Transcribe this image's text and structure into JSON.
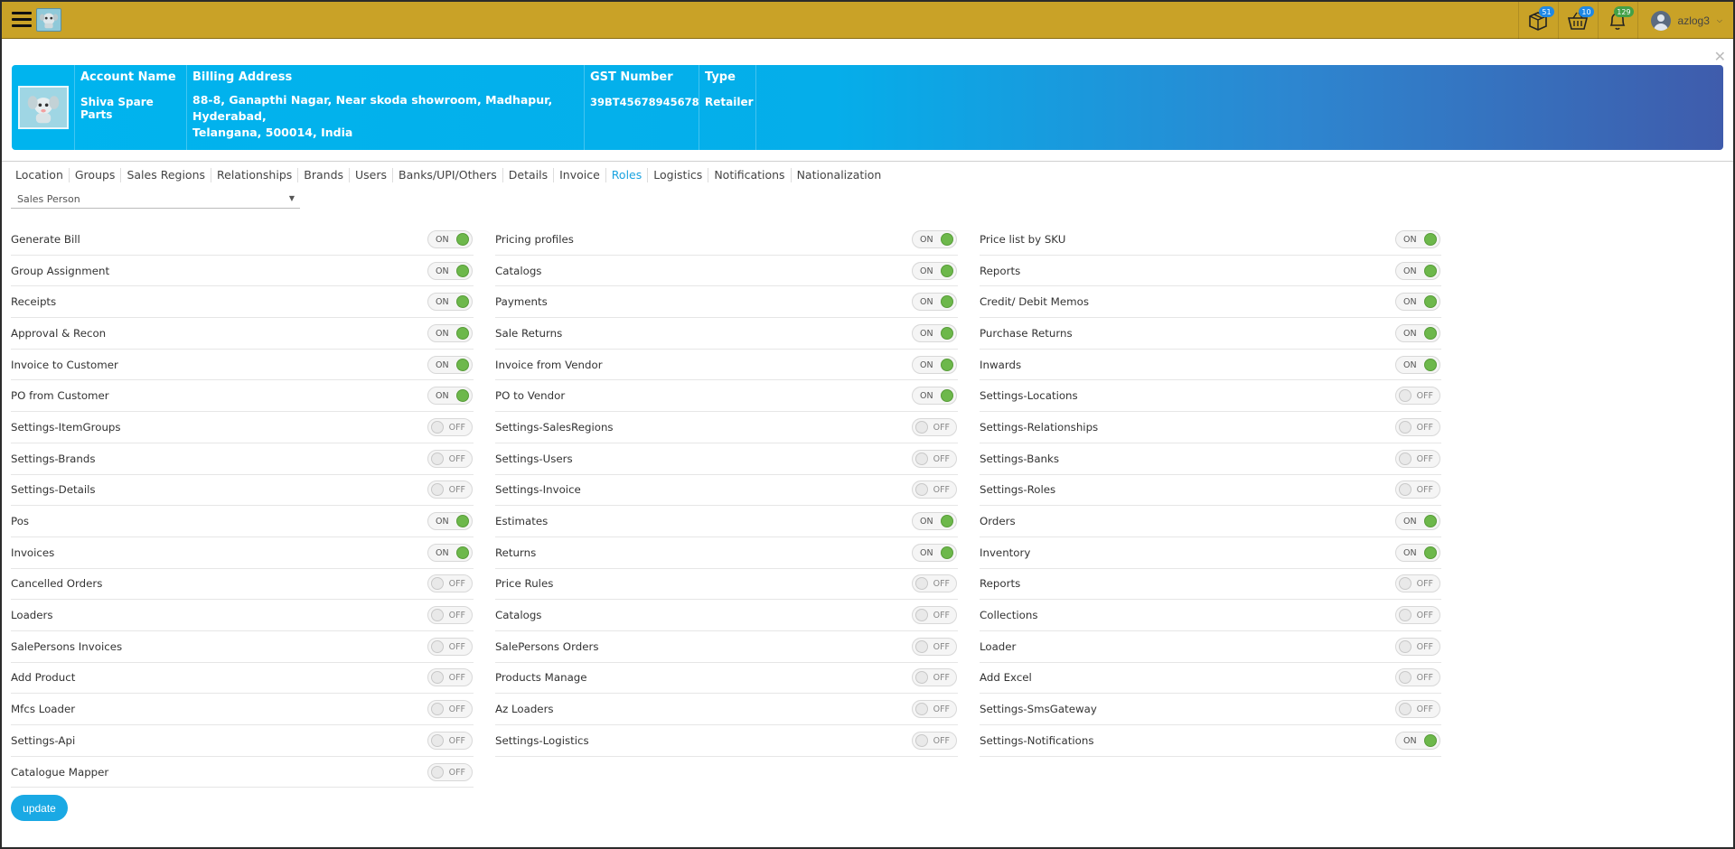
{
  "topbar": {
    "user": "azlog3",
    "badges": {
      "orders": "51",
      "cart": "10",
      "notifications": "129"
    }
  },
  "account": {
    "name_label": "Account Name",
    "name": "Shiva Spare Parts",
    "billing_label": "Billing Address",
    "billing_lines": [
      "88-8, Ganapthi Nagar, Near skoda showroom, Madhapur,",
      "Hyderabad,",
      "Telangana, 500014, India"
    ],
    "gst_label": "GST Number",
    "gst": "39BT45678945678",
    "type_label": "Type",
    "type": "Retailer"
  },
  "tabs": [
    "Location",
    "Groups",
    "Sales Regions",
    "Relationships",
    "Brands",
    "Users",
    "Banks/UPI/Others",
    "Details",
    "Invoice",
    "Roles",
    "Logistics",
    "Notifications",
    "Nationalization"
  ],
  "active_tab": "Roles",
  "role_select": "Sales Person",
  "toggle_on_text": "ON",
  "toggle_off_text": "OFF",
  "columns": [
    [
      {
        "label": "Generate Bill",
        "on": true
      },
      {
        "label": "Group Assignment",
        "on": true
      },
      {
        "label": "Receipts",
        "on": true
      },
      {
        "label": "Approval & Recon",
        "on": true
      },
      {
        "label": "Invoice to Customer",
        "on": true
      },
      {
        "label": "PO from Customer",
        "on": true
      },
      {
        "label": "Settings-ItemGroups",
        "on": false
      },
      {
        "label": "Settings-Brands",
        "on": false
      },
      {
        "label": "Settings-Details",
        "on": false
      },
      {
        "label": "Pos",
        "on": true
      },
      {
        "label": "Invoices",
        "on": true
      },
      {
        "label": "Cancelled Orders",
        "on": false
      },
      {
        "label": "Loaders",
        "on": false
      },
      {
        "label": "SalePersons Invoices",
        "on": false
      },
      {
        "label": "Add Product",
        "on": false
      },
      {
        "label": "Mfcs Loader",
        "on": false
      },
      {
        "label": "Settings-Api",
        "on": false
      },
      {
        "label": "Catalogue Mapper",
        "on": false
      }
    ],
    [
      {
        "label": "Pricing profiles",
        "on": true
      },
      {
        "label": "Catalogs",
        "on": true
      },
      {
        "label": "Payments",
        "on": true
      },
      {
        "label": "Sale Returns",
        "on": true
      },
      {
        "label": "Invoice from Vendor",
        "on": true
      },
      {
        "label": "PO to Vendor",
        "on": true
      },
      {
        "label": "Settings-SalesRegions",
        "on": false
      },
      {
        "label": "Settings-Users",
        "on": false
      },
      {
        "label": "Settings-Invoice",
        "on": false
      },
      {
        "label": "Estimates",
        "on": true
      },
      {
        "label": "Returns",
        "on": true
      },
      {
        "label": "Price Rules",
        "on": false
      },
      {
        "label": "Catalogs",
        "on": false
      },
      {
        "label": "SalePersons Orders",
        "on": false
      },
      {
        "label": "Products Manage",
        "on": false
      },
      {
        "label": "Az Loaders",
        "on": false
      },
      {
        "label": "Settings-Logistics",
        "on": false
      }
    ],
    [
      {
        "label": "Price list by SKU",
        "on": true
      },
      {
        "label": "Reports",
        "on": true
      },
      {
        "label": "Credit/ Debit Memos",
        "on": true
      },
      {
        "label": "Purchase Returns",
        "on": true
      },
      {
        "label": "Inwards",
        "on": true
      },
      {
        "label": "Settings-Locations",
        "on": false
      },
      {
        "label": "Settings-Relationships",
        "on": false
      },
      {
        "label": "Settings-Banks",
        "on": false
      },
      {
        "label": "Settings-Roles",
        "on": false
      },
      {
        "label": "Orders",
        "on": true
      },
      {
        "label": "Inventory",
        "on": true
      },
      {
        "label": "Reports",
        "on": false
      },
      {
        "label": "Collections",
        "on": false
      },
      {
        "label": "Loader",
        "on": false
      },
      {
        "label": "Add Excel",
        "on": false
      },
      {
        "label": "Settings-SmsGateway",
        "on": false
      },
      {
        "label": "Settings-Notifications",
        "on": true
      }
    ]
  ],
  "update_label": "update",
  "colors": {
    "topbar": "#c9a227",
    "accent": "#1aa9e4",
    "toggle_on": "#6db84b"
  }
}
